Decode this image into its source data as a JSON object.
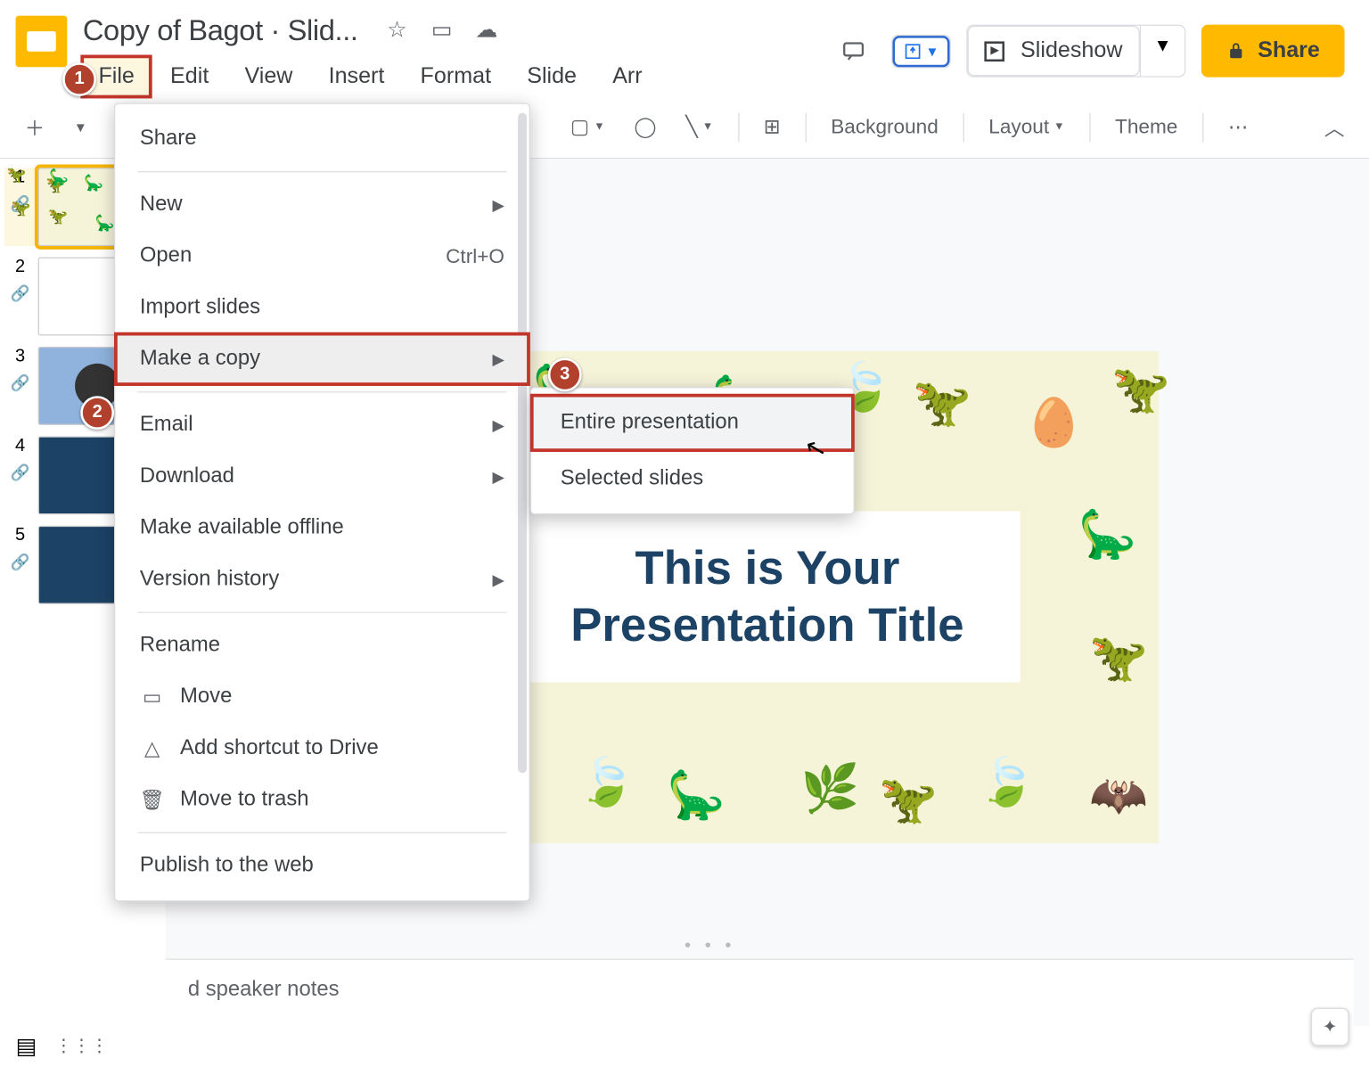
{
  "header": {
    "doc_title": "Copy of Bagot · Slid...",
    "slideshow_label": "Slideshow",
    "share_label": "Share"
  },
  "menubar": [
    "File",
    "Edit",
    "View",
    "Insert",
    "Format",
    "Slide",
    "Arr"
  ],
  "toolbar": {
    "background": "Background",
    "layout": "Layout",
    "theme": "Theme"
  },
  "file_menu": {
    "share": "Share",
    "new": "New",
    "open": "Open",
    "open_shortcut": "Ctrl+O",
    "import": "Import slides",
    "make_copy": "Make a copy",
    "email": "Email",
    "download": "Download",
    "offline": "Make available offline",
    "version": "Version history",
    "rename": "Rename",
    "move": "Move",
    "shortcut": "Add shortcut to Drive",
    "trash": "Move to trash",
    "publish": "Publish to the web"
  },
  "submenu": {
    "entire": "Entire presentation",
    "selected": "Selected slides"
  },
  "slide": {
    "title_line1": "This is Your",
    "title_line2": "Presentation Title"
  },
  "notes_placeholder": "d speaker notes",
  "badges": {
    "b1": "1",
    "b2": "2",
    "b3": "3"
  },
  "thumbs": [
    "1",
    "2",
    "3",
    "4",
    "5"
  ]
}
